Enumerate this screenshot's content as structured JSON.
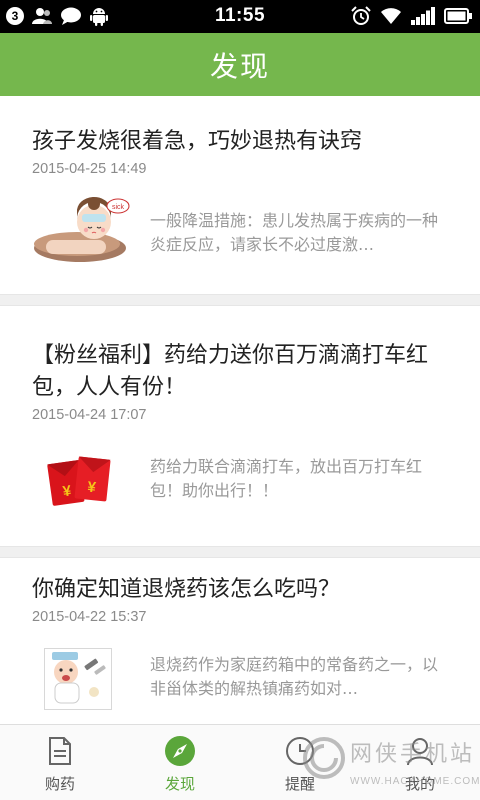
{
  "status_bar": {
    "notification_count": "3",
    "time": "11:55",
    "left_icons": [
      "notification-count-icon",
      "contacts-icon",
      "message-icon",
      "android-icon"
    ],
    "right_icons": [
      "alarm-icon",
      "wifi-icon",
      "signal-icon",
      "battery-icon"
    ]
  },
  "header": {
    "title": "发现",
    "color": "#75b74d"
  },
  "articles": [
    {
      "title": "孩子发烧很着急，巧妙退热有诀窍",
      "date": "2015-04-25 14:49",
      "summary": "一般降温措施：患儿发热属于疾病的一种炎症反应，请家长不必过度激…",
      "image": "sick-child-illustration",
      "image_text": "sick"
    },
    {
      "title": "【粉丝福利】药给力送你百万滴滴打车红包，人人有份！",
      "date": "2015-04-24 17:07",
      "summary": "药给力联合滴滴打车，放出百万打车红包！助你出行！！",
      "image": "red-envelopes-illustration",
      "image_text": "¥"
    },
    {
      "title": "你确定知道退烧药该怎么吃吗？",
      "date": "2015-04-22 15:37",
      "summary": "退烧药作为家庭药箱中的常备药之一，以非甾体类的解热镇痛药如对…",
      "image": "baby-medicine-illustration"
    }
  ],
  "tabs": [
    {
      "label": "购药",
      "icon": "document-icon",
      "active": false
    },
    {
      "label": "发现",
      "icon": "compass-icon",
      "active": true
    },
    {
      "label": "提醒",
      "icon": "clock-icon",
      "active": false
    },
    {
      "label": "我的",
      "icon": "profile-icon",
      "active": false
    }
  ],
  "colors": {
    "accent": "#75b74d",
    "tab_active": "#5aa63a",
    "tab_inactive": "#555555",
    "date_text": "#8a8a8a",
    "summary_text": "#999999"
  },
  "watermark": {
    "text_cn": "网侠手机站",
    "text_en": "WWW.HACKHOME.COM"
  }
}
